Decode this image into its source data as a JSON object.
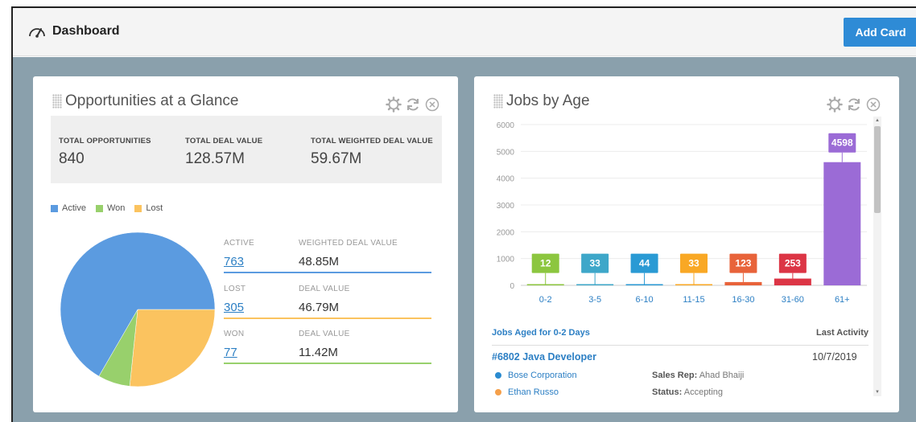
{
  "header": {
    "title": "Dashboard",
    "add_card_label": "Add Card"
  },
  "colors": {
    "active": "#5b9be0",
    "won": "#98d06c",
    "lost": "#fbc35f",
    "accent": "#2e8bd6",
    "background": "#8aa0ac"
  },
  "opportunities": {
    "title": "Opportunities at a Glance",
    "tool_icons": [
      "gear-icon",
      "refresh-icon",
      "close-icon"
    ],
    "summary": [
      {
        "label": "TOTAL OPPORTUNITIES",
        "value": "840"
      },
      {
        "label": "TOTAL DEAL VALUE",
        "value": "128.57M"
      },
      {
        "label": "TOTAL WEIGHTED DEAL VALUE",
        "value": "59.67M"
      }
    ],
    "legend": [
      "Active",
      "Won",
      "Lost"
    ],
    "details": [
      {
        "status": "ACTIVE",
        "value_label": "WEIGHTED DEAL VALUE",
        "count": "763",
        "amount": "48.85M",
        "color": "#5b9be0"
      },
      {
        "status": "LOST",
        "value_label": "DEAL VALUE",
        "count": "305",
        "amount": "46.79M",
        "color": "#fbc35f"
      },
      {
        "status": "WON",
        "value_label": "DEAL VALUE",
        "count": "77",
        "amount": "11.42M",
        "color": "#98d06c"
      }
    ]
  },
  "jobs": {
    "title": "Jobs by Age",
    "tool_icons": [
      "gear-icon",
      "refresh-icon",
      "close-icon"
    ],
    "list_header": "Jobs Aged for 0-2 Days",
    "last_activity_label": "Last Activity",
    "job": {
      "title": "#6802 Java Developer",
      "date": "10/7/2019",
      "company": "Bose Corporation",
      "contact": "Ethan Russo",
      "sales_rep_label": "Sales Rep:",
      "sales_rep": "Ahad Bhaiji",
      "status_label": "Status:",
      "status": "Accepting"
    }
  },
  "chart_data": [
    {
      "type": "pie",
      "categories": [
        "Active",
        "Won",
        "Lost"
      ],
      "values": [
        763,
        77,
        305
      ],
      "colors": [
        "#5b9be0",
        "#98d06c",
        "#fbc35f"
      ],
      "title": "",
      "legend": "top-left"
    },
    {
      "type": "bar",
      "categories": [
        "0-2",
        "3-5",
        "6-10",
        "11-15",
        "16-30",
        "31-60",
        "61+"
      ],
      "values": [
        12,
        33,
        44,
        33,
        123,
        253,
        4598
      ],
      "colors": [
        "#8cc63f",
        "#3ea7c9",
        "#2a9ad4",
        "#f9a825",
        "#e8633a",
        "#dc3545",
        "#9b6bd6"
      ],
      "yticks": [
        0,
        1000,
        2000,
        3000,
        4000,
        5000,
        6000
      ],
      "ylim": [
        0,
        6000
      ],
      "title": "",
      "xlabel": "",
      "ylabel": "",
      "grid": true
    }
  ]
}
